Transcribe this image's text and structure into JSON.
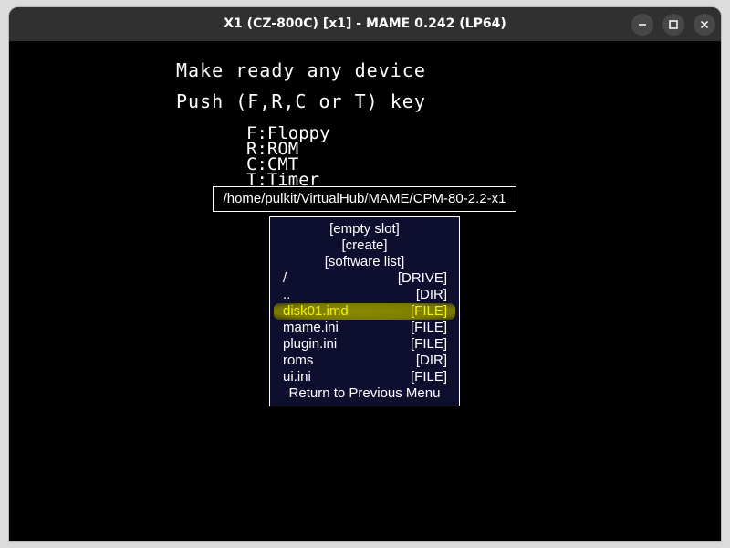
{
  "window": {
    "title": "X1 (CZ-800C) [x1] - MAME 0.242 (LP64)"
  },
  "screen": {
    "line1": "Make ready any device",
    "line2": "Push (F,R,C or T) key",
    "options": [
      "F:Floppy",
      "R:ROM",
      "C:CMT",
      "T:Timer"
    ]
  },
  "path": "/home/pulkit/VirtualHub/MAME/CPM-80-2.2-x1",
  "menu": {
    "empty_slot": "[empty slot]",
    "create": "[create]",
    "software_list": "[software list]",
    "entries": [
      {
        "name": "/",
        "kind": "[DRIVE]"
      },
      {
        "name": "..",
        "kind": "[DIR]"
      },
      {
        "name": "disk01.imd",
        "kind": "[FILE]",
        "selected": true
      },
      {
        "name": "mame.ini",
        "kind": "[FILE]"
      },
      {
        "name": "plugin.ini",
        "kind": "[FILE]"
      },
      {
        "name": "roms",
        "kind": "[DIR]"
      },
      {
        "name": "ui.ini",
        "kind": "[FILE]"
      }
    ],
    "return_label": "Return to Previous Menu"
  },
  "colors": {
    "menu_bg": "#0e0e2e",
    "selected_text": "#f2f200",
    "selected_bg": "#7a7a00",
    "titlebar": "#303030"
  },
  "icons": [
    "minimize-icon",
    "maximize-icon",
    "close-icon"
  ]
}
